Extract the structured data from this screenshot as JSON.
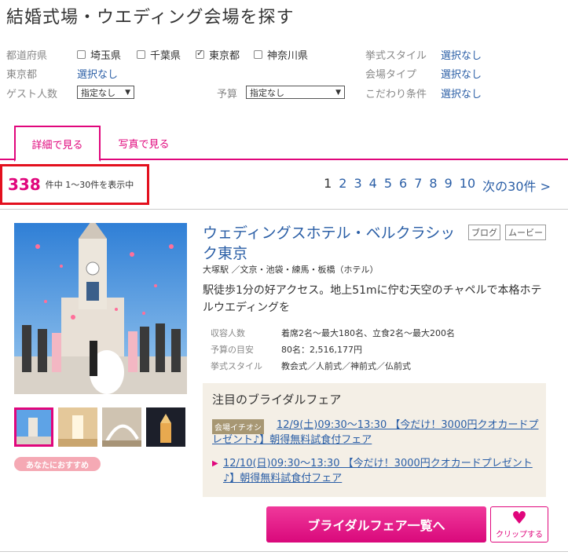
{
  "page_title": "結婚式場・ウエディング会場を探す",
  "filters": {
    "prefecture_label": "都道府県",
    "prefectures": [
      {
        "label": "埼玉県",
        "checked": false
      },
      {
        "label": "千葉県",
        "checked": false
      },
      {
        "label": "東京都",
        "checked": true
      },
      {
        "label": "神奈川県",
        "checked": false
      }
    ],
    "tokyo_label": "東京都",
    "tokyo_value": "選択なし",
    "guests_label": "ゲスト人数",
    "guests_value": "指定なし",
    "budget_label": "予算",
    "budget_value": "指定なし",
    "style_label": "挙式スタイル",
    "style_value": "選択なし",
    "venue_type_label": "会場タイプ",
    "venue_type_value": "選択なし",
    "conditions_label": "こだわり条件",
    "conditions_value": "選択なし"
  },
  "tabs": {
    "detail": "詳細で見る",
    "photo": "写真で見る"
  },
  "results": {
    "count": "338",
    "text": "件中 1〜30件を表示中"
  },
  "pager": {
    "pages": [
      "1",
      "2",
      "3",
      "4",
      "5",
      "6",
      "7",
      "8",
      "9",
      "10"
    ],
    "next": "次の30件 >"
  },
  "venue": {
    "name": "ウェディングスホテル・ベルクラシック東京",
    "tags": [
      "ブログ",
      "ムービー"
    ],
    "area": "大塚駅 ／文京・池袋・練馬・板橋（ホテル）",
    "catch": "駅徒歩1分の好アクセス。地上51mに佇む天空のチャペルで本格ホテルウエディングを",
    "specs": [
      {
        "key": "収容人数",
        "value": "着席2名〜最大180名、立食2名〜最大200名"
      },
      {
        "key": "予算の目安",
        "value": "80名：2,516,177円"
      },
      {
        "key": "挙式スタイル",
        "value": "教会式／人前式／神前式／仏前式"
      }
    ],
    "recommend_badge": "あなたにおすすめ"
  },
  "fair": {
    "title": "注目のブライダルフェア",
    "badge": "会場イチオシ",
    "item1": "12/9(土)09:30〜13:30 【今だけ！3000円クオカードプレゼント♪】朝得無料試食付フェア",
    "item2": "12/10(日)09:30〜13:30 【今だけ！3000円クオカードプレゼント♪】朝得無料試食付フェア"
  },
  "buttons": {
    "fair_list": "ブライダルフェア一覧へ",
    "clip": "クリップする"
  },
  "colors": {
    "accent": "#e0067c",
    "link": "#2a5ea6",
    "highlight_border": "#e3101e"
  }
}
